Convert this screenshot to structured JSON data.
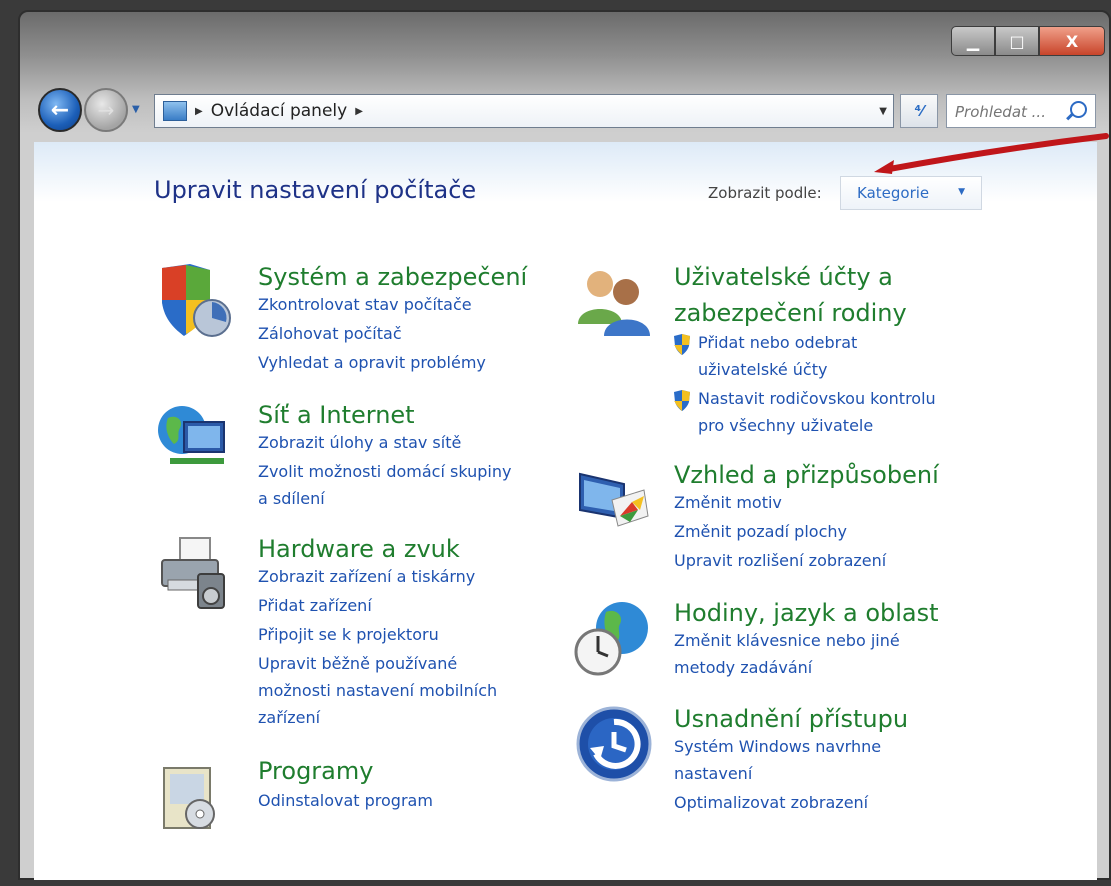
{
  "window": {
    "controls": {
      "minimize": "▁",
      "maximize": "□",
      "close": "X"
    }
  },
  "nav": {
    "back_icon": "arrow-left-icon",
    "forward_icon": "arrow-right-icon",
    "history_arrow": "▼",
    "breadcrumb_sep": "▶",
    "address_text": "Ovládací panely",
    "address_drop": "▼",
    "refresh_symbol": "⁴⁄",
    "search_placeholder": "Prohledat ..."
  },
  "header": {
    "page_title": "Upravit nastavení počítače",
    "view_label": "Zobrazit podle:",
    "view_value": "Kategorie",
    "view_caret": "▼"
  },
  "colors": {
    "title_green": "#1f7d2e",
    "link_blue": "#1f52b0",
    "heading_blue": "#1e3287",
    "annotation_red": "#c0161a"
  },
  "categories": {
    "system": {
      "icon": "shield-icon",
      "title": "Systém a zabezpečení",
      "links": [
        "Zkontrolovat stav počítače",
        "Zálohovat počítač",
        "Vyhledat a opravit problémy"
      ]
    },
    "network": {
      "icon": "globe-network-icon",
      "title": "Síť a Internet",
      "links": [
        "Zobrazit úlohy a stav sítě",
        "Zvolit možnosti domácí skupiny",
        "a sdílení"
      ]
    },
    "hardware": {
      "icon": "printer-icon",
      "title": "Hardware a zvuk",
      "links": [
        "Zobrazit zařízení a tiskárny",
        "Přidat zařízení",
        "Připojit se k projektoru",
        "Upravit běžně používané",
        "možnosti nastavení mobilních",
        "zařízení"
      ]
    },
    "programs": {
      "icon": "programs-icon",
      "title": "Programy",
      "links": [
        "Odinstalovat program"
      ]
    },
    "users": {
      "icon": "users-icon",
      "title_line1": "Uživatelské účty a",
      "title_line2": "zabezpečení rodiny",
      "links": [
        "Přidat nebo odebrat",
        "uživatelské účty",
        "Nastavit rodičovskou kontrolu",
        "pro všechny uživatele"
      ]
    },
    "appearance": {
      "icon": "display-color-icon",
      "title": "Vzhled a přizpůsobení",
      "links": [
        "Změnit motiv",
        "Změnit pozadí plochy",
        "Upravit rozlišení zobrazení"
      ]
    },
    "clock": {
      "icon": "clock-globe-icon",
      "title": "Hodiny, jazyk a oblast",
      "links": [
        "Změnit klávesnice nebo jiné",
        "metody zadávání"
      ]
    },
    "access": {
      "icon": "ease-of-access-icon",
      "title": "Usnadnění přístupu",
      "links": [
        "Systém Windows navrhne",
        "nastavení",
        "Optimalizovat zobrazení"
      ]
    }
  }
}
